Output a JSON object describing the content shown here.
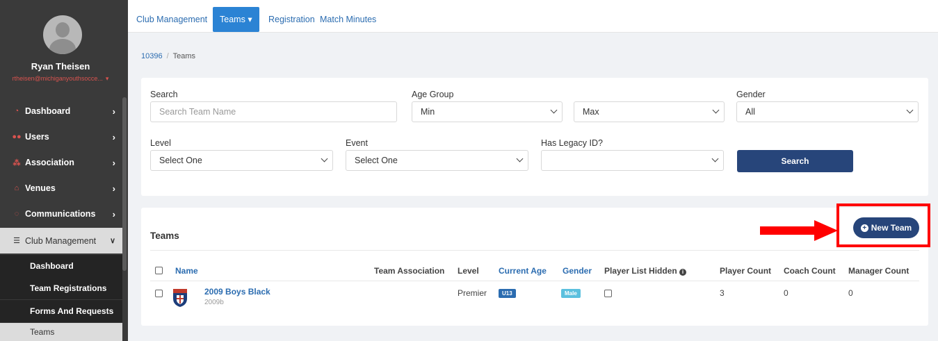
{
  "sidebar": {
    "user_name": "Ryan Theisen",
    "user_email": "rtheisen@michiganyouthsocce...",
    "nav": [
      {
        "label": "Dashboard",
        "icon": "dashboard-icon"
      },
      {
        "label": "Users",
        "icon": "users-icon"
      },
      {
        "label": "Association",
        "icon": "association-icon"
      },
      {
        "label": "Venues",
        "icon": "venues-icon"
      },
      {
        "label": "Communications",
        "icon": "communications-icon"
      },
      {
        "label": "Club Management",
        "icon": "club-management-icon"
      }
    ],
    "sub": [
      {
        "label": "Dashboard"
      },
      {
        "label": "Team Registrations"
      },
      {
        "label": "Forms And Requests"
      },
      {
        "label": "Teams"
      }
    ]
  },
  "topnav": {
    "tabs": [
      {
        "label": "Club Management"
      },
      {
        "label": "Teams"
      },
      {
        "label": "Registration"
      },
      {
        "label": "Match Minutes"
      }
    ],
    "active_caret": "▾"
  },
  "breadcrumb": {
    "root": "10396",
    "separator": "/",
    "current": "Teams"
  },
  "filters": {
    "search_label": "Search",
    "search_placeholder": "Search Team Name",
    "age_group_label": "Age Group",
    "age_min": "Min",
    "age_max": "Max",
    "gender_label": "Gender",
    "gender_value": "All",
    "level_label": "Level",
    "level_value": "Select One",
    "event_label": "Event",
    "event_value": "Select One",
    "legacy_label": "Has Legacy ID?",
    "legacy_value": "",
    "search_button": "Search"
  },
  "teams": {
    "title": "Teams",
    "new_team_button": "New Team",
    "columns": {
      "name": "Name",
      "association": "Team Association",
      "level": "Level",
      "current_age": "Current Age",
      "gender": "Gender",
      "player_list_hidden": "Player List Hidden",
      "player_count": "Player Count",
      "coach_count": "Coach Count",
      "manager_count": "Manager Count"
    },
    "rows": [
      {
        "name": "2009 Boys Black",
        "code": "2009b",
        "level": "Premier",
        "age": "U13",
        "gender": "Male",
        "player_count": "3",
        "coach_count": "0",
        "manager_count": "0"
      }
    ]
  },
  "colors": {
    "primary": "#27457a",
    "link": "#2b6cb0",
    "highlight": "#ff0000",
    "sidebar": "#3a3a3a"
  }
}
